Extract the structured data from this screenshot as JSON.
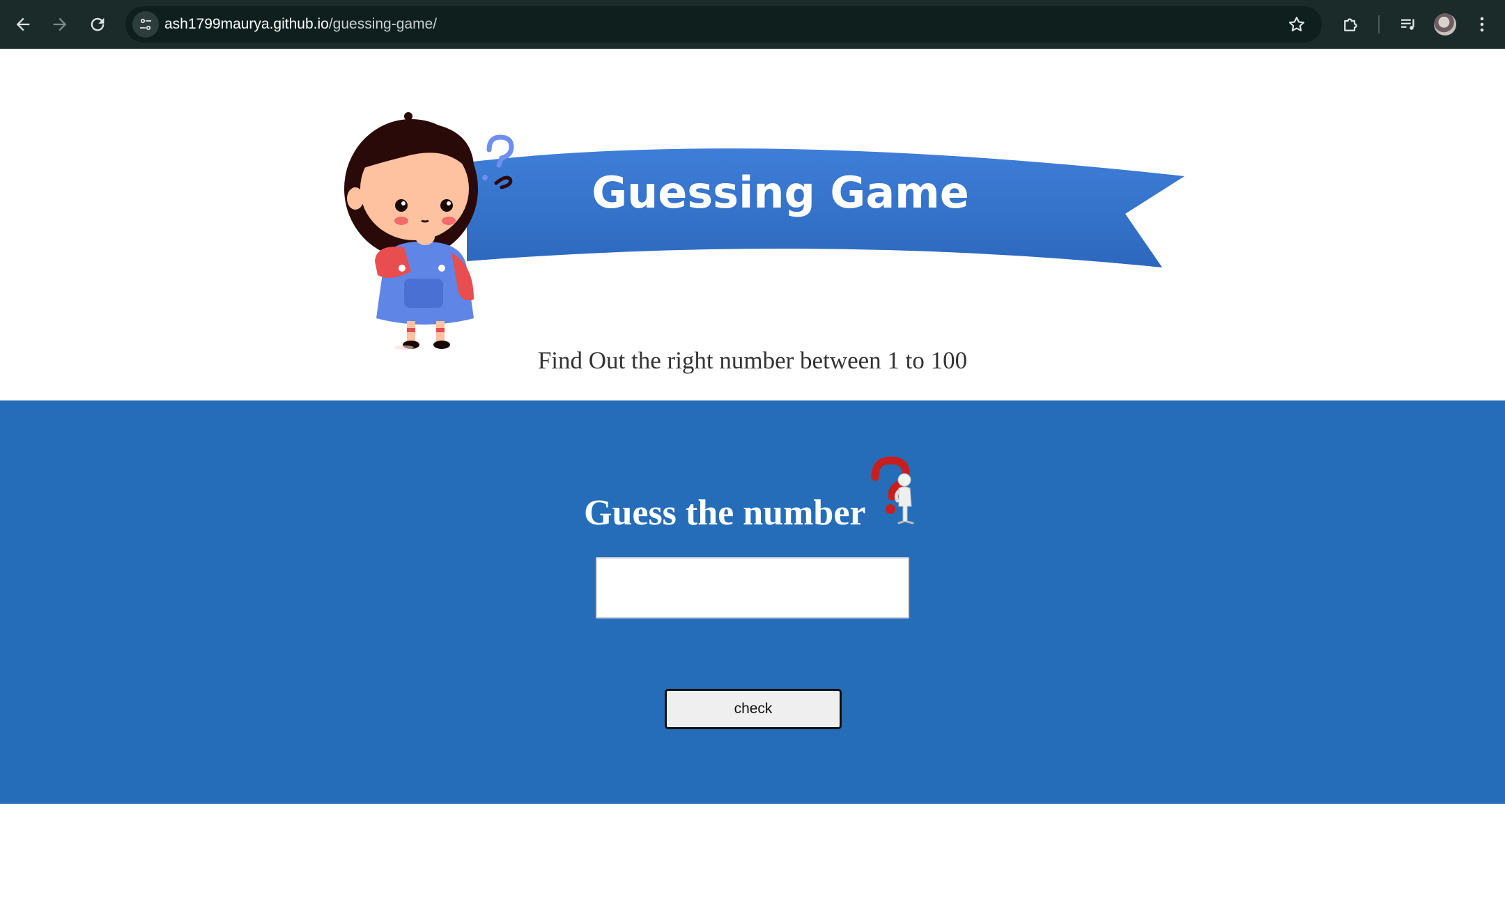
{
  "browser": {
    "url_host": "ash1799maurya.github.io",
    "url_path": "/guessing-game/",
    "icons": {
      "back": "arrow-left-icon",
      "forward": "arrow-right-icon",
      "reload": "reload-icon",
      "site_info": "tune-icon",
      "bookmark": "star-icon",
      "extensions": "puzzle-icon",
      "media": "media-queue-icon",
      "profile": "avatar",
      "menu": "kebab-menu-icon"
    },
    "colors": {
      "frame": "#1a2b2a",
      "omnibox": "#0f1f1e"
    }
  },
  "header": {
    "title": "Guessing Game",
    "subtitle": "Find Out the right number between 1 to 100",
    "ribbon_color": "#3a76cf"
  },
  "game": {
    "heading": "Guess the number",
    "input_value": "",
    "input_placeholder": "",
    "check_label": "check",
    "background_color": "#256db8"
  }
}
